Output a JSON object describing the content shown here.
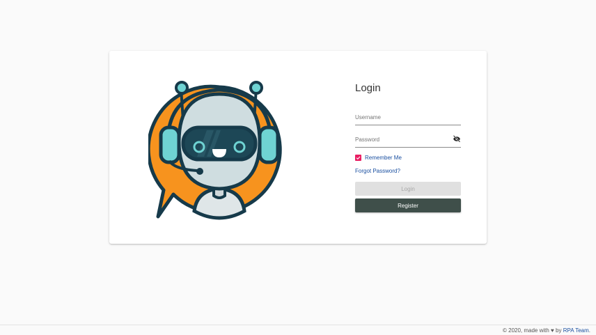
{
  "login": {
    "title": "Login",
    "username_placeholder": "Username",
    "password_placeholder": "Password",
    "remember_label": "Remember Me",
    "remember_checked": true,
    "forgot_label": "Forgot Password?",
    "login_button": "Login",
    "register_button": "Register"
  },
  "footer": {
    "prefix": "© 2020, made with ",
    "heart": "♥",
    "by": " by ",
    "team_link": "RPA Team",
    "suffix": "."
  },
  "colors": {
    "accent_pink": "#e91e63",
    "link_blue": "#1a4fa0",
    "register_button": "#3f4f4a",
    "illustration_orange": "#f7931e",
    "illustration_teal": "#6fd3d3",
    "illustration_navy": "#163a4a"
  },
  "icons": {
    "password_toggle": "eye-off-icon",
    "checkbox": "checkmark-icon",
    "illustration": "chatbot-robot-headset"
  }
}
